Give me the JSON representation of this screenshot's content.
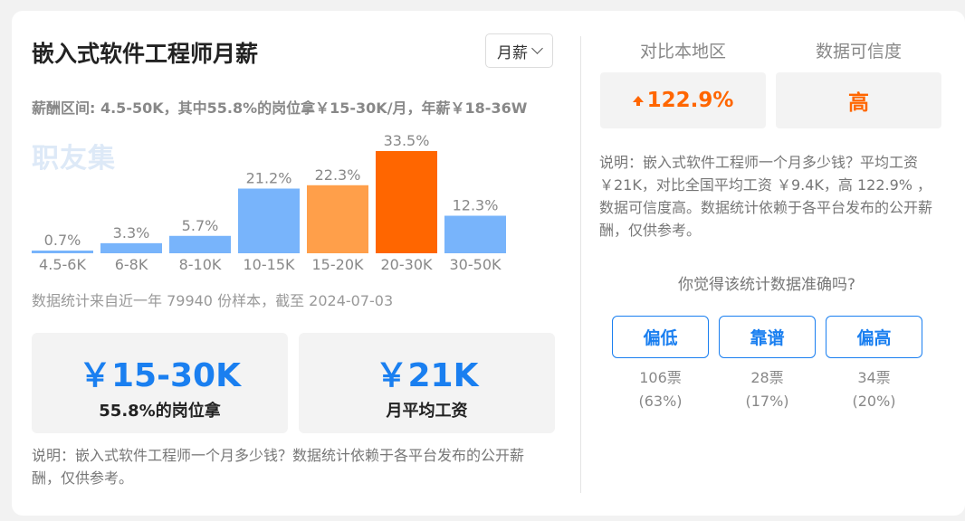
{
  "header": {
    "title": "嵌入式软件工程师月薪",
    "period_select": "月薪"
  },
  "salary_range_text": "薪酬区间: 4.5-50K，其中55.8%的岗位拿￥15-30K/月，年薪￥18-36W",
  "watermark": "职友集",
  "chart_data": {
    "type": "bar",
    "categories": [
      "4.5-6K",
      "6-8K",
      "8-10K",
      "10-15K",
      "15-20K",
      "20-30K",
      "30-50K"
    ],
    "values": [
      0.7,
      3.3,
      5.7,
      21.2,
      22.3,
      33.5,
      12.3
    ],
    "value_labels": [
      "0.7%",
      "3.3%",
      "5.7%",
      "21.2%",
      "22.3%",
      "33.5%",
      "12.3%"
    ],
    "colors": [
      "#78b4fb",
      "#78b4fb",
      "#78b4fb",
      "#78b4fb",
      "#ff9f4a",
      "#ff6600",
      "#78b4fb"
    ],
    "title": "",
    "xlabel": "",
    "ylabel": "",
    "grid": false,
    "legend": "none"
  },
  "sample_text": "数据统计来自近一年 79940 份样本，截至 2024-07-03",
  "stats": {
    "range_value": "￥15-30K",
    "range_label": "55.8%的岗位拿",
    "avg_value": "￥21K",
    "avg_label": "月平均工资"
  },
  "note_left": "说明：嵌入式软件工程师一个月多少钱？数据统计依赖于各平台发布的公开薪酬，仅供参考。",
  "comparison": {
    "local_header": "对比本地区",
    "local_value": "122.9%",
    "trust_header": "数据可信度",
    "trust_value": "高"
  },
  "note_right": "说明：嵌入式软件工程师一个月多少钱？平均工资 ￥21K，对比全国平均工资 ￥9.4K，高 122.9% ，数据可信度高。数据统计依赖于各平台发布的公开薪酬，仅供参考。",
  "poll": {
    "question": "你觉得该统计数据准确吗?",
    "options": [
      {
        "label": "偏低",
        "votes": "106票",
        "percent": "(63%)"
      },
      {
        "label": "靠谱",
        "votes": "28票",
        "percent": "(17%)"
      },
      {
        "label": "偏高",
        "votes": "34票",
        "percent": "(20%)"
      }
    ]
  },
  "colors": {
    "accent_blue": "#1a7ff0",
    "accent_orange": "#ff6600"
  }
}
